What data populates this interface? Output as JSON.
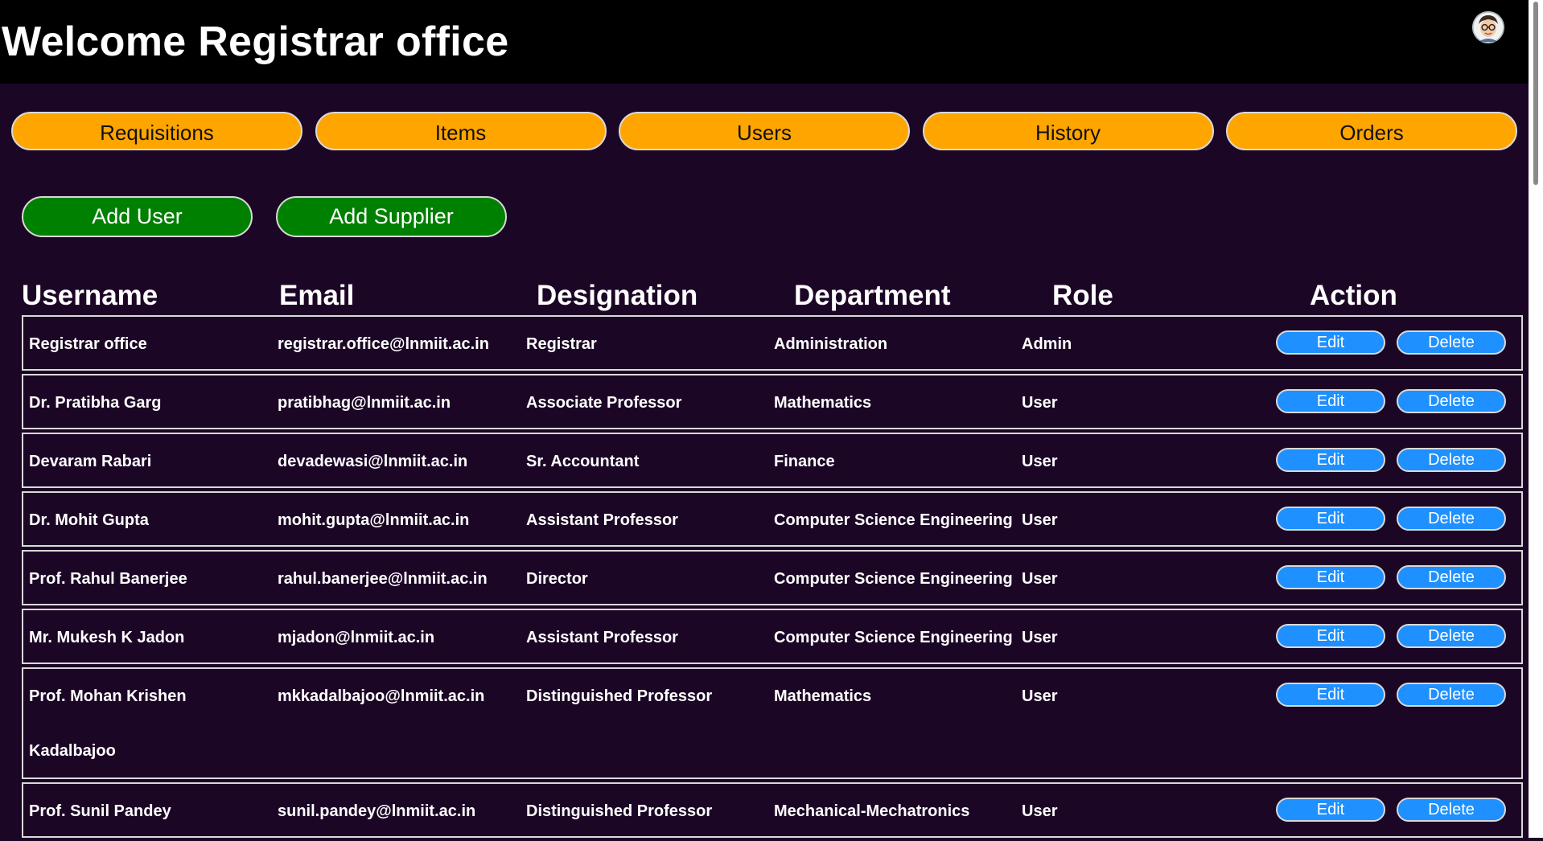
{
  "header": {
    "title": "Welcome Registrar office"
  },
  "nav": [
    {
      "label": "Requisitions"
    },
    {
      "label": "Items"
    },
    {
      "label": "Users"
    },
    {
      "label": "History"
    },
    {
      "label": "Orders"
    }
  ],
  "actions": {
    "add_user": "Add User",
    "add_supplier": "Add Supplier"
  },
  "table": {
    "headers": [
      "Username",
      "Email",
      "Designation",
      "Department",
      "Role",
      "Action"
    ],
    "edit_label": "Edit",
    "delete_label": "Delete",
    "rows": [
      {
        "username": "Registrar office",
        "email": "registrar.office@lnmiit.ac.in",
        "designation": "Registrar",
        "department": "Administration",
        "role": "Admin"
      },
      {
        "username": "Dr. Pratibha Garg",
        "email": "pratibhag@lnmiit.ac.in",
        "designation": "Associate Professor",
        "department": "Mathematics",
        "role": "User"
      },
      {
        "username": "Devaram Rabari",
        "email": "devadewasi@lnmiit.ac.in",
        "designation": "Sr. Accountant",
        "department": "Finance",
        "role": "User"
      },
      {
        "username": "Dr. Mohit Gupta",
        "email": "mohit.gupta@lnmiit.ac.in",
        "designation": "Assistant Professor",
        "department": "Computer Science Engineering",
        "role": "User"
      },
      {
        "username": "Prof. Rahul Banerjee",
        "email": "rahul.banerjee@lnmiit.ac.in",
        "designation": "Director",
        "department": "Computer Science Engineering",
        "role": "User"
      },
      {
        "username": "Mr. Mukesh K Jadon",
        "email": "mjadon@lnmiit.ac.in",
        "designation": "Assistant Professor",
        "department": "Computer Science Engineering",
        "role": "User"
      },
      {
        "username": "Prof. Mohan Krishen Kadalbajoo",
        "email": "mkkadalbajoo@lnmiit.ac.in",
        "designation": "Distinguished Professor",
        "department": "Mathematics",
        "role": "User"
      },
      {
        "username": "Prof. Sunil Pandey",
        "email": "sunil.pandey@lnmiit.ac.in",
        "designation": "Distinguished Professor",
        "department": "Mechanical-Mechatronics",
        "role": "User"
      }
    ]
  }
}
